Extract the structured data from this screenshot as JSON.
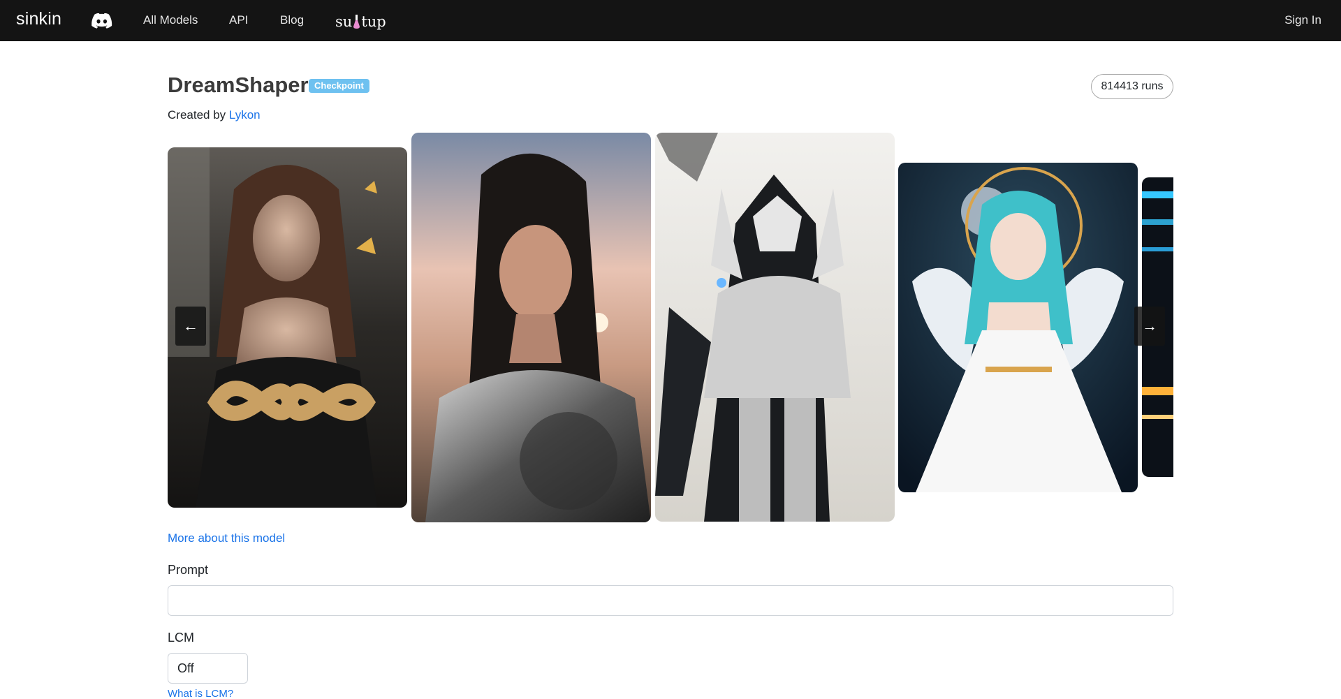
{
  "nav": {
    "brand": "sinkin",
    "links": [
      "All Models",
      "API",
      "Blog"
    ],
    "partner": "su  tup",
    "signin": "Sign In"
  },
  "model": {
    "name": "DreamShaper",
    "badge": "Checkpoint",
    "runs": "814413 runs",
    "created_by": "Created by",
    "author": "Lykon"
  },
  "gallery": {
    "prev": "←",
    "next": "→"
  },
  "more_link": "More about this model",
  "form": {
    "prompt_label": "Prompt",
    "prompt_value": "",
    "lcm_label": "LCM",
    "lcm_value": "Off",
    "lcm_help": "What is LCM?"
  },
  "colors": {
    "navbar": "#141414",
    "badge": "#6ec1f0",
    "link": "#1a73e8"
  }
}
